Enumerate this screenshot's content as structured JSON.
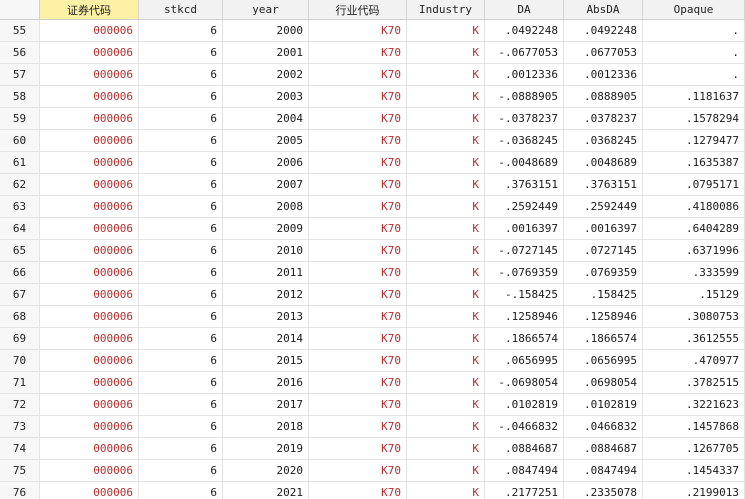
{
  "columns": [
    "证券代码",
    "stkcd",
    "year",
    "行业代码",
    "Industry",
    "DA",
    "AbsDA",
    "Opaque"
  ],
  "rows": [
    {
      "n": "55",
      "code": "000006",
      "stkcd": "6",
      "year": "2000",
      "ind_code": "K70",
      "industry": "K",
      "da": ".0492248",
      "absda": ".0492248",
      "opaque": "."
    },
    {
      "n": "56",
      "code": "000006",
      "stkcd": "6",
      "year": "2001",
      "ind_code": "K70",
      "industry": "K",
      "da": "-.0677053",
      "absda": ".0677053",
      "opaque": "."
    },
    {
      "n": "57",
      "code": "000006",
      "stkcd": "6",
      "year": "2002",
      "ind_code": "K70",
      "industry": "K",
      "da": ".0012336",
      "absda": ".0012336",
      "opaque": "."
    },
    {
      "n": "58",
      "code": "000006",
      "stkcd": "6",
      "year": "2003",
      "ind_code": "K70",
      "industry": "K",
      "da": "-.0888905",
      "absda": ".0888905",
      "opaque": ".1181637"
    },
    {
      "n": "59",
      "code": "000006",
      "stkcd": "6",
      "year": "2004",
      "ind_code": "K70",
      "industry": "K",
      "da": "-.0378237",
      "absda": ".0378237",
      "opaque": ".1578294"
    },
    {
      "n": "60",
      "code": "000006",
      "stkcd": "6",
      "year": "2005",
      "ind_code": "K70",
      "industry": "K",
      "da": "-.0368245",
      "absda": ".0368245",
      "opaque": ".1279477"
    },
    {
      "n": "61",
      "code": "000006",
      "stkcd": "6",
      "year": "2006",
      "ind_code": "K70",
      "industry": "K",
      "da": "-.0048689",
      "absda": ".0048689",
      "opaque": ".1635387"
    },
    {
      "n": "62",
      "code": "000006",
      "stkcd": "6",
      "year": "2007",
      "ind_code": "K70",
      "industry": "K",
      "da": ".3763151",
      "absda": ".3763151",
      "opaque": ".0795171"
    },
    {
      "n": "63",
      "code": "000006",
      "stkcd": "6",
      "year": "2008",
      "ind_code": "K70",
      "industry": "K",
      "da": ".2592449",
      "absda": ".2592449",
      "opaque": ".4180086"
    },
    {
      "n": "64",
      "code": "000006",
      "stkcd": "6",
      "year": "2009",
      "ind_code": "K70",
      "industry": "K",
      "da": ".0016397",
      "absda": ".0016397",
      "opaque": ".6404289"
    },
    {
      "n": "65",
      "code": "000006",
      "stkcd": "6",
      "year": "2010",
      "ind_code": "K70",
      "industry": "K",
      "da": "-.0727145",
      "absda": ".0727145",
      "opaque": ".6371996"
    },
    {
      "n": "66",
      "code": "000006",
      "stkcd": "6",
      "year": "2011",
      "ind_code": "K70",
      "industry": "K",
      "da": "-.0769359",
      "absda": ".0769359",
      "opaque": ".333599"
    },
    {
      "n": "67",
      "code": "000006",
      "stkcd": "6",
      "year": "2012",
      "ind_code": "K70",
      "industry": "K",
      "da": "-.158425",
      "absda": ".158425",
      "opaque": ".15129"
    },
    {
      "n": "68",
      "code": "000006",
      "stkcd": "6",
      "year": "2013",
      "ind_code": "K70",
      "industry": "K",
      "da": ".1258946",
      "absda": ".1258946",
      "opaque": ".3080753"
    },
    {
      "n": "69",
      "code": "000006",
      "stkcd": "6",
      "year": "2014",
      "ind_code": "K70",
      "industry": "K",
      "da": ".1866574",
      "absda": ".1866574",
      "opaque": ".3612555"
    },
    {
      "n": "70",
      "code": "000006",
      "stkcd": "6",
      "year": "2015",
      "ind_code": "K70",
      "industry": "K",
      "da": ".0656995",
      "absda": ".0656995",
      "opaque": ".470977"
    },
    {
      "n": "71",
      "code": "000006",
      "stkcd": "6",
      "year": "2016",
      "ind_code": "K70",
      "industry": "K",
      "da": "-.0698054",
      "absda": ".0698054",
      "opaque": ".3782515"
    },
    {
      "n": "72",
      "code": "000006",
      "stkcd": "6",
      "year": "2017",
      "ind_code": "K70",
      "industry": "K",
      "da": ".0102819",
      "absda": ".0102819",
      "opaque": ".3221623"
    },
    {
      "n": "73",
      "code": "000006",
      "stkcd": "6",
      "year": "2018",
      "ind_code": "K70",
      "industry": "K",
      "da": "-.0466832",
      "absda": ".0466832",
      "opaque": ".1457868"
    },
    {
      "n": "74",
      "code": "000006",
      "stkcd": "6",
      "year": "2019",
      "ind_code": "K70",
      "industry": "K",
      "da": ".0884687",
      "absda": ".0884687",
      "opaque": ".1267705"
    },
    {
      "n": "75",
      "code": "000006",
      "stkcd": "6",
      "year": "2020",
      "ind_code": "K70",
      "industry": "K",
      "da": ".0847494",
      "absda": ".0847494",
      "opaque": ".1454337"
    },
    {
      "n": "76",
      "code": "000006",
      "stkcd": "6",
      "year": "2021",
      "ind_code": "K70",
      "industry": "K",
      "da": ".2177251",
      "absda": ".2335078",
      "opaque": ".2199013"
    }
  ]
}
